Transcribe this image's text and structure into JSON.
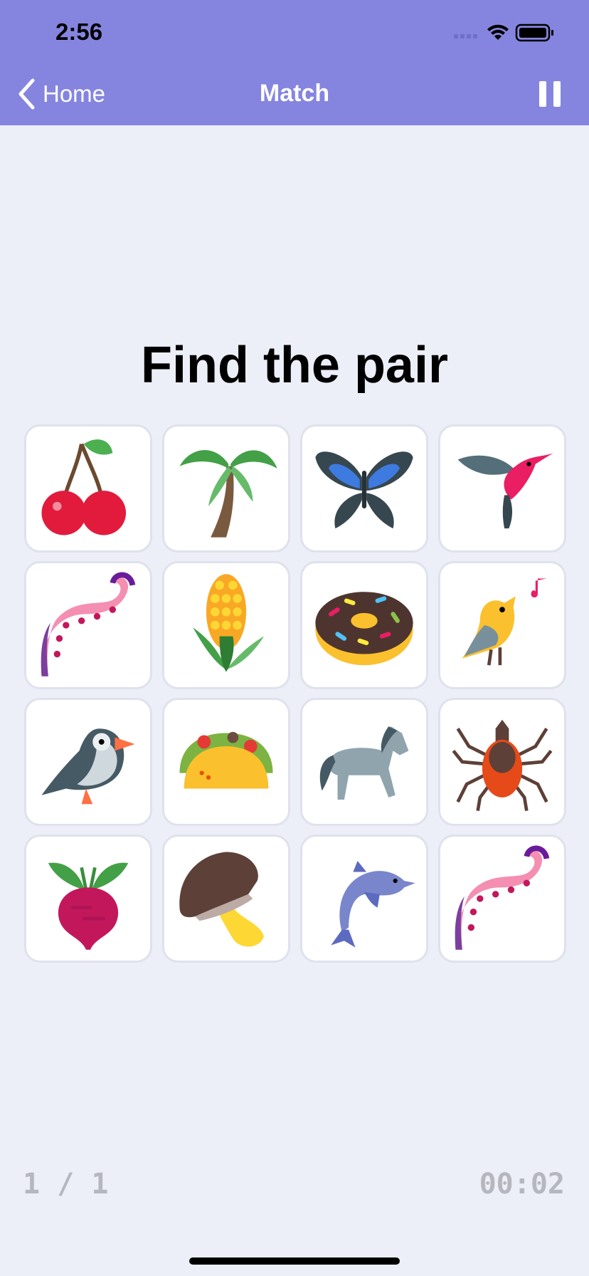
{
  "status_bar": {
    "time": "2:56"
  },
  "nav": {
    "back_label": "Home",
    "title": "Match"
  },
  "heading": "Find the pair",
  "cards": [
    "cherries-icon",
    "palm-tree-icon",
    "butterfly-icon",
    "hummingbird-icon",
    "octopus-tentacle-icon",
    "corn-icon",
    "donut-icon",
    "singing-bird-icon",
    "puffin-icon",
    "taco-icon",
    "horse-icon",
    "tick-bug-icon",
    "beet-icon",
    "mushroom-icon",
    "dolphin-icon",
    "octopus-tentacle-icon"
  ],
  "footer": {
    "progress": "1 / 1",
    "timer": "00:02"
  }
}
